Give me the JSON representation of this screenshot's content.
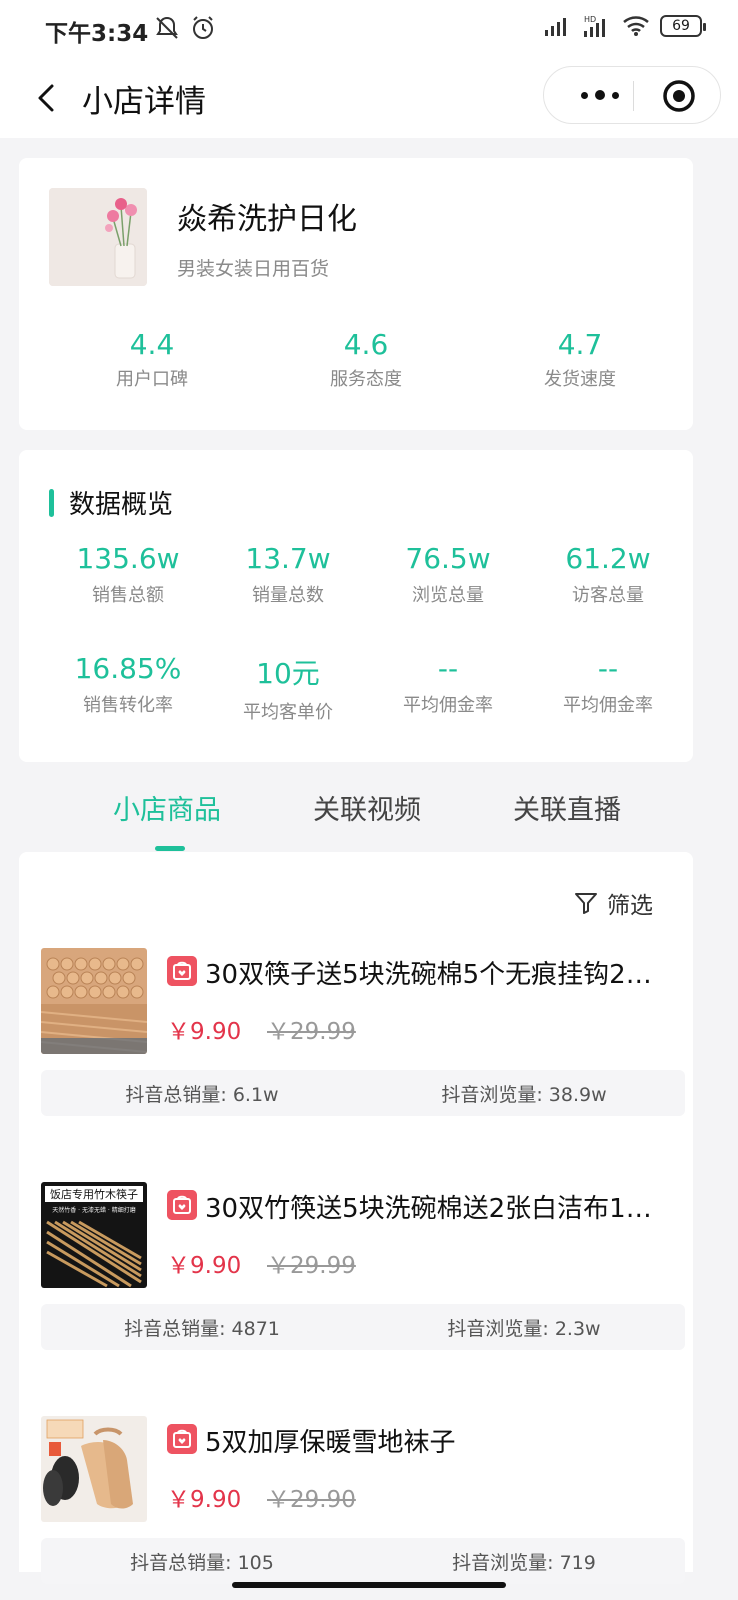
{
  "status_bar": {
    "time": "下午3:34",
    "battery": "69",
    "icons": [
      "silent-icon",
      "alarm-icon",
      "signal-icon",
      "hd-signal-icon",
      "wifi-icon",
      "battery-icon"
    ]
  },
  "nav": {
    "title": "小店详情",
    "icons": [
      "back-icon",
      "more-icon",
      "close-target-icon"
    ]
  },
  "shop": {
    "name": "焱希洗护日化",
    "category": "男装女装日用百货",
    "ratings": [
      {
        "value": "4.4",
        "label": "用户口碑"
      },
      {
        "value": "4.6",
        "label": "服务态度"
      },
      {
        "value": "4.7",
        "label": "发货速度"
      }
    ]
  },
  "overview": {
    "title": "数据概览",
    "row1": [
      {
        "value": "135.6w",
        "label": "销售总额"
      },
      {
        "value": "13.7w",
        "label": "销量总数"
      },
      {
        "value": "76.5w",
        "label": "浏览总量"
      },
      {
        "value": "61.2w",
        "label": "访客总量"
      }
    ],
    "row2": [
      {
        "value": "16.85%",
        "label": "销售转化率"
      },
      {
        "value": "10元",
        "label": "平均客单价"
      },
      {
        "value": "--",
        "label": "平均佣金率"
      },
      {
        "value": "--",
        "label": "平均佣金率"
      }
    ]
  },
  "tabs": [
    "小店商品",
    "关联视频",
    "关联直播"
  ],
  "filter_label": "筛选",
  "colors": {
    "accent": "#1ec09a",
    "price": "#e3344a",
    "tag": "#ee5361"
  },
  "products": [
    {
      "title": "30双筷子送5块洗碗棉5个无痕挂钩2…",
      "price": "￥9.90",
      "original": "￥29.99",
      "sales": "抖音总销量: 6.1w",
      "views": "抖音浏览量: 38.9w"
    },
    {
      "title": "30双竹筷送5块洗碗棉送2张白洁布1…",
      "price": "￥9.90",
      "original": "￥29.99",
      "sales": "抖音总销量: 4871",
      "views": "抖音浏览量: 2.3w",
      "thumb_text": "饭店专用竹木筷子",
      "thumb_subtext": "天然竹香 · 无漆无蜡 · 精细打磨"
    },
    {
      "title": "5双加厚保暖雪地袜子",
      "price": "￥9.90",
      "original": "￥29.90",
      "sales": "抖音总销量: 105",
      "views": "抖音浏览量: 719"
    }
  ]
}
